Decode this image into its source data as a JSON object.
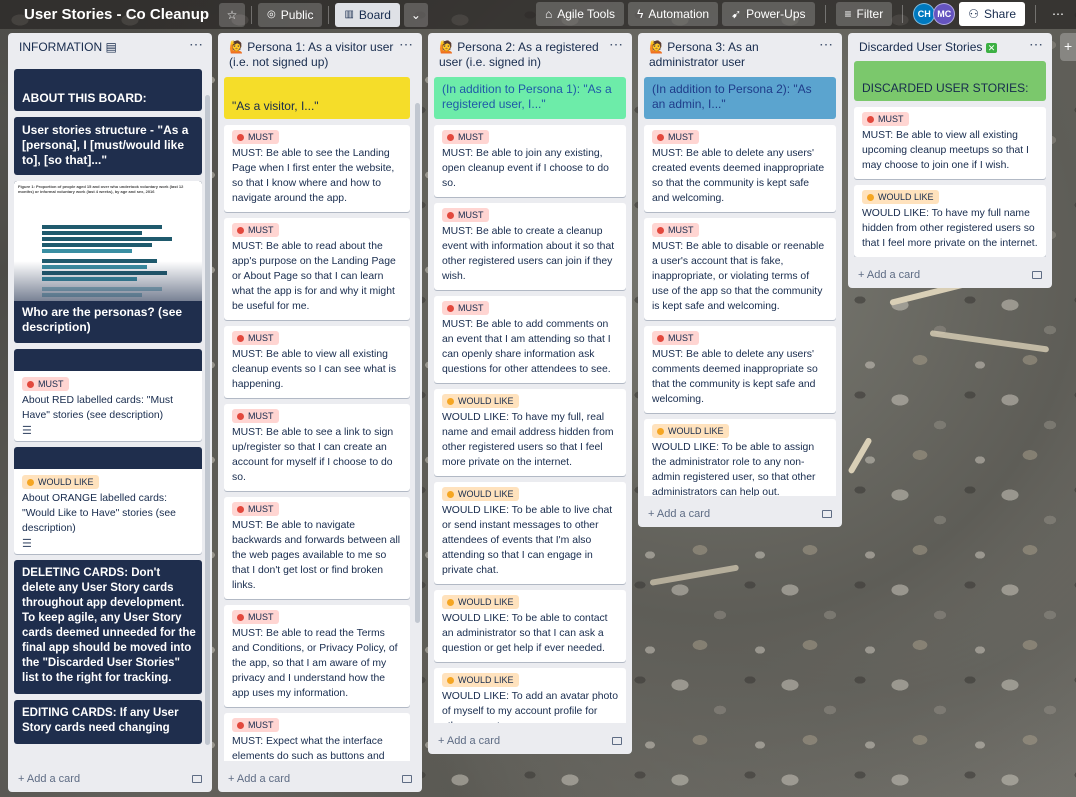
{
  "header": {
    "board_title": "User Stories - Co Cleanup",
    "visibility": "Public",
    "view": "Board",
    "agile_tools": "Agile Tools",
    "automation": "Automation",
    "power_ups": "Power-Ups",
    "filter": "Filter",
    "share": "Share",
    "members": [
      {
        "initials": "CH",
        "color": "#0079bf"
      },
      {
        "initials": "MC",
        "color": "#6554c0"
      }
    ]
  },
  "lists": {
    "info": {
      "title": "INFORMATION",
      "cards": {
        "about": "ABOUT THIS BOARD:",
        "structure": "User stories structure - \"As a [persona], I [must/would like to], [so that]...\"",
        "personas": "Who are the personas? (see description)",
        "red_label": "MUST",
        "red_text": "About RED labelled cards: \"Must Have\" stories (see description)",
        "orange_label": "WOULD LIKE",
        "orange_text": "About ORANGE labelled cards: \"Would Like to Have\" stories (see description)",
        "deleting": "DELETING CARDS: Don't delete any User Story cards throughout app development. To keep agile, any User Story cards deemed unneeded for the final app should be moved into the \"Discarded User Stories\" list to the right for tracking.",
        "editing": "EDITING CARDS: If any User Story cards need changing"
      },
      "chart_title": "Figure 1: Proportion of people aged 15 and over who undertook voluntary work (last 12 months) or informal voluntary work (last 4 weeks), by age and sex, 2016",
      "add": "Add a card"
    },
    "p1": {
      "title": "Persona 1: As a visitor user (i.e. not signed up)",
      "cover": "\"As a visitor, I...\"",
      "cards": [
        {
          "label": "MUST",
          "text": "MUST: Be able to see the Landing Page when I first enter the website, so that I know where and how to navigate around the app."
        },
        {
          "label": "MUST",
          "text": "MUST: Be able to read about the app's purpose on the Landing Page or About Page so that I can learn what the app is for and why it might be useful for me."
        },
        {
          "label": "MUST",
          "text": "MUST: Be able to view all existing cleanup events so I can see what is happening."
        },
        {
          "label": "MUST",
          "text": "MUST: Be able to see a link to sign up/register so that I can create an account for myself if I choose to do so."
        },
        {
          "label": "MUST",
          "text": "MUST: Be able to navigate backwards and forwards between all the web pages available to me so that I don't get lost or find broken links."
        },
        {
          "label": "MUST",
          "text": "MUST: Be able to read the Terms and Conditions, or Privacy Policy, of the app, so that I am aware of my privacy and I understand how the app uses my information."
        },
        {
          "label": "MUST",
          "text": "MUST: Expect what the interface elements do such as buttons and input fields so that I know how to interact with the application."
        }
      ],
      "add": "Add a card"
    },
    "p2": {
      "title": "Persona 2: As a registered user (i.e. signed in)",
      "cover": "(In addition to Persona 1): \"As a registered user, I...\"",
      "cards": [
        {
          "label": "MUST",
          "text": "MUST: Be able to join any existing, open cleanup event if I choose to do so."
        },
        {
          "label": "MUST",
          "text": "MUST: Be able to create a cleanup event with information about it so that other registered users can join if they wish."
        },
        {
          "label": "MUST",
          "text": "MUST: Be able to add comments on an event that I am attending so that I can openly share information ask questions for other attendees to see."
        },
        {
          "label": "WOULD LIKE",
          "text": "WOULD LIKE: To have my full, real name and email address hidden from other registered users so that I feel more private on the internet."
        },
        {
          "label": "WOULD LIKE",
          "text": "WOULD LIKE: To be able to live chat or send instant messages to other attendees of events that I'm also attending so that I can engage in private chat."
        },
        {
          "label": "WOULD LIKE",
          "text": "WOULD LIKE: To be able to contact an administrator so that I can ask a question or get help if ever needed."
        },
        {
          "label": "WOULD LIKE",
          "text": "WOULD LIKE: To add an avatar photo of myself to my account profile for other users to see."
        }
      ],
      "add": "Add a card"
    },
    "p3": {
      "title": "Persona 3: As an administrator user",
      "cover": "(In addition to Persona 2): \"As an admin, I...\"",
      "cards": [
        {
          "label": "MUST",
          "text": "MUST: Be able to delete any users' created events deemed inappropriate so that the community is kept safe and welcoming."
        },
        {
          "label": "MUST",
          "text": "MUST: Be able to disable or reenable a user's account that is fake, inappropriate, or violating terms of use of the app so that the community is kept safe and welcoming."
        },
        {
          "label": "MUST",
          "text": "MUST: Be able to delete any users' comments deemed inappropriate so that the community is kept safe and welcoming."
        },
        {
          "label": "WOULD LIKE",
          "text": "WOULD LIKE: To be able to assign the administrator role to any non-admin registered user, so that other administrators can help out."
        }
      ],
      "add": "Add a card"
    },
    "discarded": {
      "title": "Discarded User Stories",
      "cover": "DISCARDED USER STORIES:",
      "cards": [
        {
          "label": "MUST",
          "text": "MUST: Be able to view all existing upcoming cleanup meetups so that I may choose to join one if I wish."
        },
        {
          "label": "WOULD LIKE",
          "text": "WOULD LIKE: To have my full name hidden from other registered users so that I feel more private on the internet."
        }
      ],
      "add": "Add a card"
    }
  },
  "colors": {
    "header_bg": "#282624",
    "list_bg": "#ebecf0",
    "navy_cover": "#1f2e4d",
    "p1_cover": "#f5dd29",
    "p2_cover": "#6deca9",
    "p3_cover": "#5ba4cf",
    "discarded_cover": "#7bc86c",
    "must_label": "#e2483d",
    "would_label": "#f5a623"
  }
}
